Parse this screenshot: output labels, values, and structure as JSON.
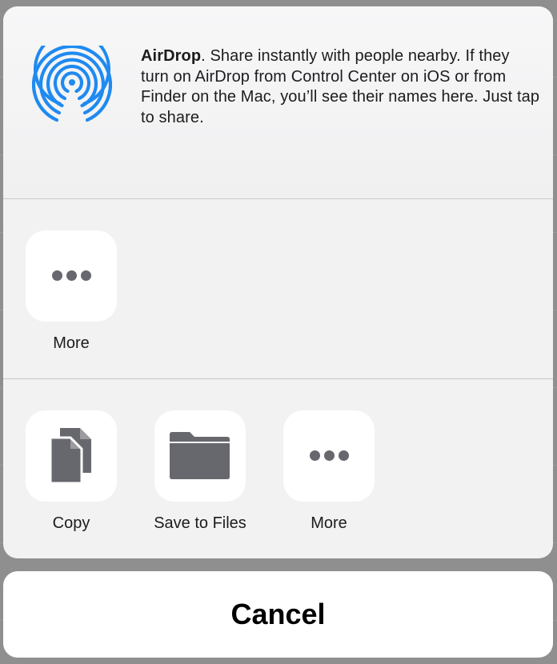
{
  "airdrop": {
    "title": "AirDrop",
    "description": ". Share instantly with people nearby. If they turn on AirDrop from Control Center on iOS or from Finder on the Mac, you’ll see their names here. Just tap to share."
  },
  "row1": [
    {
      "label": "More",
      "icon": "ellipsis-icon"
    }
  ],
  "row2": [
    {
      "label": "Copy",
      "icon": "copy-icon"
    },
    {
      "label": "Save to Files",
      "icon": "folder-icon"
    },
    {
      "label": "More",
      "icon": "ellipsis-icon"
    }
  ],
  "cancel_label": "Cancel",
  "colors": {
    "accent": "#1f8af0",
    "icon_gray": "#67676e",
    "sheet_bg": "#f2f2f3"
  }
}
